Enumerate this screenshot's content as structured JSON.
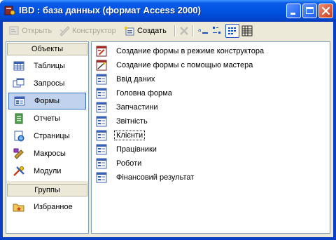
{
  "window": {
    "title": "IBD : база данных (формат Access 2000)",
    "controls": {
      "minimize": "minimize",
      "maximize": "maximize",
      "close": "close"
    }
  },
  "toolbar": {
    "open_label": "Открыть",
    "design_label": "Конструктор",
    "create_label": "Создать",
    "views": [
      "large-icons",
      "small-icons",
      "list",
      "details"
    ],
    "active_view": "list"
  },
  "sidebar": {
    "objects_header": "Объекты",
    "items": [
      {
        "label": "Таблицы",
        "icon": "table-icon"
      },
      {
        "label": "Запросы",
        "icon": "query-icon"
      },
      {
        "label": "Формы",
        "icon": "form-icon",
        "selected": true
      },
      {
        "label": "Отчеты",
        "icon": "report-icon"
      },
      {
        "label": "Страницы",
        "icon": "page-icon"
      },
      {
        "label": "Макросы",
        "icon": "macro-icon"
      },
      {
        "label": "Модули",
        "icon": "module-icon"
      }
    ],
    "groups_header": "Группы",
    "groups": [
      {
        "label": "Избранное",
        "icon": "favorites-icon"
      }
    ]
  },
  "list": {
    "items": [
      {
        "label": "Создание формы в режиме конструктора",
        "icon": "design-shortcut-icon"
      },
      {
        "label": "Создание формы с помощью мастера",
        "icon": "wizard-shortcut-icon"
      },
      {
        "label": "Ввід даних",
        "icon": "form-icon"
      },
      {
        "label": "Головна форма",
        "icon": "form-icon"
      },
      {
        "label": "Запчастини",
        "icon": "form-icon"
      },
      {
        "label": "Звітність",
        "icon": "form-icon"
      },
      {
        "label": "Клієнти",
        "icon": "form-icon",
        "focused": true
      },
      {
        "label": "Працівники",
        "icon": "form-icon"
      },
      {
        "label": "Роботи",
        "icon": "form-icon"
      },
      {
        "label": "Фінансовий результат",
        "icon": "form-icon"
      }
    ]
  },
  "colors": {
    "titlebar": "#0053e1",
    "face": "#ece9d8",
    "selection": "#c1d2ee",
    "border": "#7f9db9"
  }
}
